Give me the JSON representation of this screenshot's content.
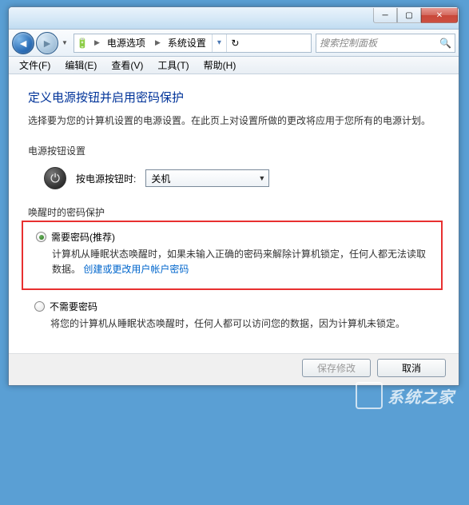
{
  "breadcrumb": {
    "seg1": "电源选项",
    "seg2": "系统设置"
  },
  "search": {
    "placeholder": "搜索控制面板"
  },
  "menu": {
    "file": "文件(F)",
    "edit": "编辑(E)",
    "view": "查看(V)",
    "tools": "工具(T)",
    "help": "帮助(H)"
  },
  "page": {
    "title": "定义电源按钮并启用密码保护",
    "desc": "选择要为您的计算机设置的电源设置。在此页上对设置所做的更改将应用于您所有的电源计划。"
  },
  "powerButton": {
    "sectionLabel": "电源按钮设置",
    "label": "按电源按钮时:",
    "value": "关机"
  },
  "password": {
    "sectionLabel": "唤醒时的密码保护",
    "opt1": {
      "label": "需要密码(推荐)",
      "desc_a": "计算机从睡眠状态唤醒时，如果未输入正确的密码来解除计算机锁定，任何人都无法读取数据。",
      "link": "创建或更改用户帐户密码"
    },
    "opt2": {
      "label": "不需要密码",
      "desc": "将您的计算机从睡眠状态唤醒时，任何人都可以访问您的数据，因为计算机未锁定。"
    }
  },
  "buttons": {
    "save": "保存修改",
    "cancel": "取消"
  },
  "watermark": "系统之家"
}
